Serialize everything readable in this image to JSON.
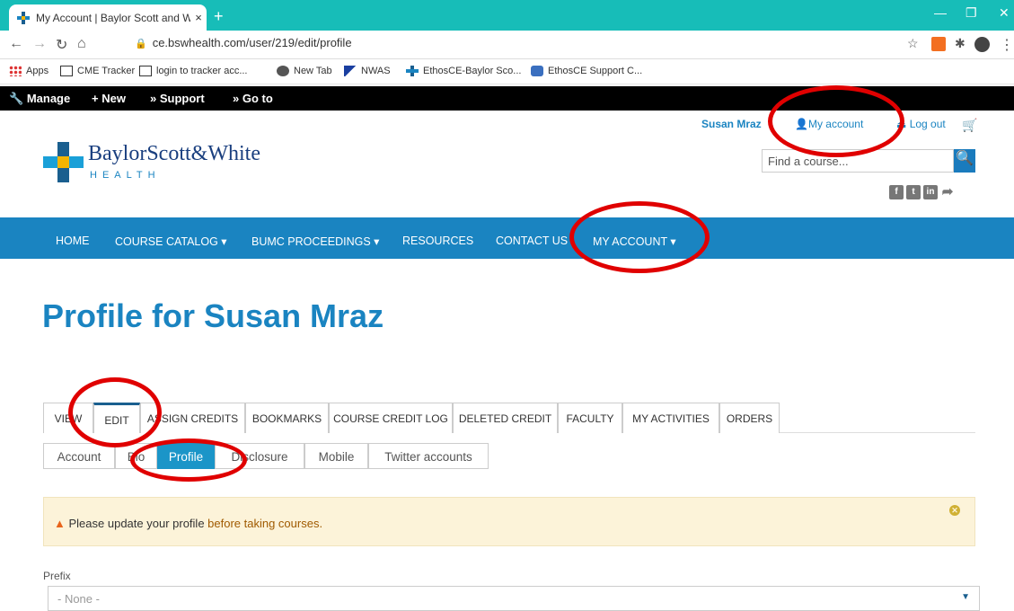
{
  "browser": {
    "tab_title": "My Account | Baylor Scott and W",
    "tab_close": "×",
    "new_tab": "+",
    "url": "ce.bswhealth.com/user/219/edit/profile",
    "bookmarks": [
      {
        "label": "Apps"
      },
      {
        "label": "CME Tracker"
      },
      {
        "label": "login to tracker acc..."
      },
      {
        "label": "New Tab"
      },
      {
        "label": "NWAS"
      },
      {
        "label": "EthosCE-Baylor Sco..."
      },
      {
        "label": "EthosCE Support C..."
      }
    ]
  },
  "adminbar": {
    "manage": "Manage",
    "new": "New",
    "support": "Support",
    "goto": "Go to"
  },
  "header": {
    "user_name": "Susan Mraz",
    "my_account": "My account",
    "logout": "Log out",
    "logo_name": "BaylorScott&White",
    "logo_sub": "HEALTH",
    "search_placeholder": "Find a course..."
  },
  "mainnav": {
    "items": [
      "HOME",
      "COURSE CATALOG ▾",
      "BUMC PROCEEDINGS ▾",
      "RESOURCES",
      "CONTACT US",
      "MY ACCOUNT ▾"
    ]
  },
  "page_title": "Profile for Susan Mraz",
  "primary_tabs": [
    "VIEW",
    "EDIT",
    "ASSIGN CREDITS",
    "BOOKMARKS",
    "COURSE CREDIT LOG",
    "DELETED CREDIT",
    "FACULTY",
    "MY ACTIVITIES",
    "ORDERS"
  ],
  "secondary_tabs": [
    "Account",
    "Bio",
    "Profile",
    "Disclosure",
    "Mobile",
    "Twitter accounts"
  ],
  "alert": {
    "text_a": "Please update your profile ",
    "text_b": "before taking courses.",
    "color": "#fcf3d9"
  },
  "form": {
    "prefix_label": "Prefix",
    "prefix_value": "- None -"
  },
  "colors": {
    "brand_blue": "#1a84c1",
    "tab_teal": "#17bdb8",
    "highlight_red": "#e00000"
  }
}
